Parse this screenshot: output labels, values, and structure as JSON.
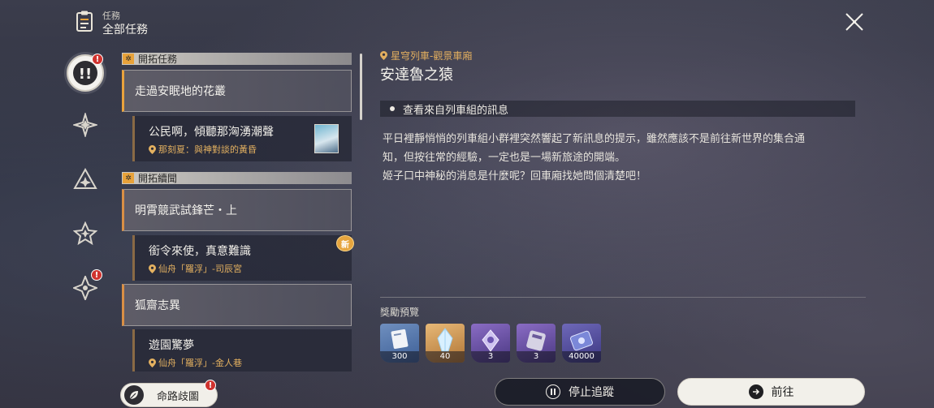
{
  "header": {
    "category": "任務",
    "title": "全部任務"
  },
  "rail": {
    "active_badge": "!",
    "badge_text": "!"
  },
  "sections": [
    {
      "label": "開拓任務"
    },
    {
      "label": "開拓續聞"
    }
  ],
  "quests": [
    {
      "title": "走過安眠地的花叢"
    },
    {
      "title": "公民啊，傾聽那洶湧潮聲",
      "location": "那刻夏：與神對談的黃昏"
    },
    {
      "title": "明霄競武試鋒芒・上"
    },
    {
      "title": "銜令來使，真意難識",
      "location": "仙舟「羅浮」-司辰宮",
      "new_badge": "新"
    },
    {
      "title": "狐齋志異"
    },
    {
      "title": "遊園驚夢",
      "location": "仙舟「羅浮」-金人巷"
    }
  ],
  "detail": {
    "location": "星穹列車-觀景車廂",
    "title": "安達魯之猿",
    "objective": "查看來自列車組的訊息",
    "description": [
      "平日裡靜悄悄的列車組小群裡突然響起了新訊息的提示，雖然應該不是前往新世界的集合通",
      "知，但按往常的經驗，一定也是一場新旅途的開端。",
      "姬子口中神秘的消息是什麼呢？回車廂找她問個清楚吧！"
    ],
    "reward_label": "獎勵預覽",
    "rewards": [
      {
        "count": "300"
      },
      {
        "count": "40"
      },
      {
        "count": "3"
      },
      {
        "count": "3"
      },
      {
        "count": "40000"
      }
    ]
  },
  "buttons": {
    "map": "命路歧圖",
    "stop": "停止追蹤",
    "go": "前往"
  },
  "colors": {
    "accent": "#e9a33c",
    "location": "#e2ae5f",
    "badge": "#d0332f"
  }
}
